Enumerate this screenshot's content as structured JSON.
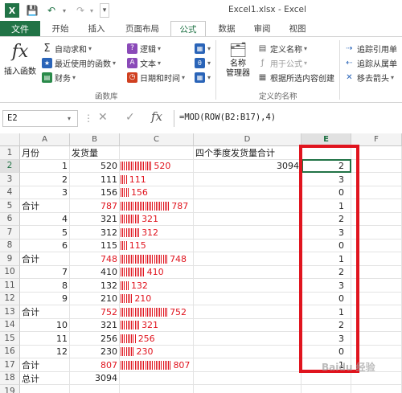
{
  "window": {
    "title": "Excel1.xlsx - Excel",
    "qat_icons": [
      "excel-logo-icon",
      "save-icon",
      "undo-icon",
      "redo-icon",
      "customize-qat-icon"
    ]
  },
  "tabs": {
    "file": "文件",
    "items": [
      "开始",
      "插入",
      "页面布局",
      "公式",
      "数据",
      "审阅",
      "视图"
    ],
    "active": "公式"
  },
  "ribbon": {
    "insert_function": "插入函数",
    "insert_function_glyph": "fx",
    "autosum": "自动求和",
    "recently_used": "最近使用的函数",
    "financial": "财务",
    "logical": "逻辑",
    "text": "文本",
    "datetime": "日期和时间",
    "library_group": "函数库",
    "name_manager": "名称\n管理器",
    "define_name": "定义名称",
    "use_in_formula": "用于公式",
    "create_from_selection": "根据所选内容创建",
    "defined_names_group": "定义的名称",
    "trace_precedents": "追踪引用单",
    "trace_dependents": "追踪从属单",
    "remove_arrows": "移去箭头"
  },
  "formula_bar": {
    "name_box": "E2",
    "cancel_glyph": "✕",
    "enter_glyph": "✓",
    "fx_glyph": "fx",
    "formula": "=MOD(ROW(B2:B17),4)"
  },
  "sheet": {
    "columns": [
      "A",
      "B",
      "C",
      "D",
      "E",
      "F"
    ],
    "selected_column": "E",
    "selected_row": 2,
    "headers": {
      "A1": "月份",
      "B1": "发货量",
      "D1": "四个季度发货量合计"
    },
    "D2": "3094",
    "rows": [
      {
        "row": 2,
        "a": "1",
        "b": "520",
        "c": "520",
        "e": "2"
      },
      {
        "row": 3,
        "a": "2",
        "b": "111",
        "c": "111",
        "e": "3"
      },
      {
        "row": 4,
        "a": "3",
        "b": "156",
        "c": "156",
        "e": "0"
      },
      {
        "row": 5,
        "a": "合计",
        "b": "787",
        "c": "787",
        "e": "1",
        "total": true
      },
      {
        "row": 6,
        "a": "4",
        "b": "321",
        "c": "321",
        "e": "2"
      },
      {
        "row": 7,
        "a": "5",
        "b": "312",
        "c": "312",
        "e": "3"
      },
      {
        "row": 8,
        "a": "6",
        "b": "115",
        "c": "115",
        "e": "0"
      },
      {
        "row": 9,
        "a": "合计",
        "b": "748",
        "c": "748",
        "e": "1",
        "total": true
      },
      {
        "row": 10,
        "a": "7",
        "b": "410",
        "c": "410",
        "e": "2"
      },
      {
        "row": 11,
        "a": "8",
        "b": "132",
        "c": "132",
        "e": "3"
      },
      {
        "row": 12,
        "a": "9",
        "b": "210",
        "c": "210",
        "e": "0"
      },
      {
        "row": 13,
        "a": "合计",
        "b": "752",
        "c": "752",
        "e": "1",
        "total": true
      },
      {
        "row": 14,
        "a": "10",
        "b": "321",
        "c": "321",
        "e": "2"
      },
      {
        "row": 15,
        "a": "11",
        "b": "256",
        "c": "256",
        "e": "3"
      },
      {
        "row": 16,
        "a": "12",
        "b": "230",
        "c": "230",
        "e": "0"
      },
      {
        "row": 17,
        "a": "合计",
        "b": "807",
        "c": "807",
        "e": "1",
        "total": true
      },
      {
        "row": 18,
        "a": "总计",
        "b": "3094",
        "c": "",
        "e": ""
      },
      {
        "row": 19,
        "a": "",
        "b": "",
        "c": "",
        "e": ""
      }
    ],
    "data_bar_ticks": [
      18,
      4,
      5,
      28,
      11,
      11,
      4,
      27,
      14,
      5,
      7,
      27,
      11,
      9,
      8,
      29
    ],
    "red_color": "#e0141e",
    "accent_color": "#217346"
  },
  "watermark": "Baidu 经验"
}
